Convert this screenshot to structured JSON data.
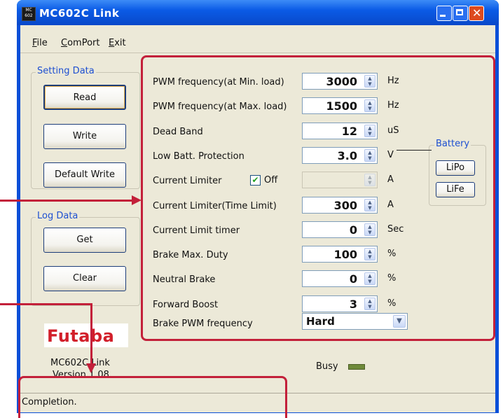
{
  "window": {
    "title": "MC602C Link",
    "icon_line1": "MC",
    "icon_line2": "602"
  },
  "menu": [
    {
      "label": "File",
      "key": "F",
      "rest": "ile"
    },
    {
      "label": "ComPort",
      "key": "C",
      "rest": "omPort"
    },
    {
      "label": "Exit",
      "key": "E",
      "rest": "xit"
    }
  ],
  "setting_data": {
    "title": "Setting Data",
    "read": "Read",
    "write": "Write",
    "default_write": "Default Write"
  },
  "log_data": {
    "title": "Log Data",
    "get": "Get",
    "clear": "Clear"
  },
  "brand": {
    "logo": "Futaba",
    "app_name": "MC602C Link",
    "version": "Version 1.08"
  },
  "params": [
    {
      "label": "PWM frequency(at Min. load)",
      "value": "3000",
      "unit": "Hz"
    },
    {
      "label": "PWM frequency(at Max. load)",
      "value": "1500",
      "unit": "Hz"
    },
    {
      "label": "Dead Band",
      "value": "12",
      "unit": "uS"
    },
    {
      "label": "Low Batt. Protection",
      "value": "3.0",
      "unit": "V"
    },
    {
      "label": "Current Limiter",
      "value": "",
      "unit": "A",
      "checkbox_label": "Off",
      "checked": true
    },
    {
      "label": "Current Limiter(Time Limit)",
      "value": "300",
      "unit": "A"
    },
    {
      "label": "Current Limit timer",
      "value": "0",
      "unit": "Sec"
    },
    {
      "label": "Brake Max. Duty",
      "value": "100",
      "unit": "%"
    },
    {
      "label": "Neutral Brake",
      "value": "0",
      "unit": "%"
    },
    {
      "label": "Forward Boost",
      "value": "3",
      "unit": "%"
    }
  ],
  "brake_pwm": {
    "label": "Brake PWM frequency",
    "value": "Hard"
  },
  "battery": {
    "title": "Battery",
    "lipo": "LiPo",
    "life": "LiFe"
  },
  "busy": {
    "label": "Busy"
  },
  "status": {
    "text": "Completion."
  },
  "colors": {
    "annotation_red": "#c3203a",
    "title_blue": "#0b5be6",
    "group_title": "#1d4fd1",
    "logo_red": "#d21f2a"
  }
}
